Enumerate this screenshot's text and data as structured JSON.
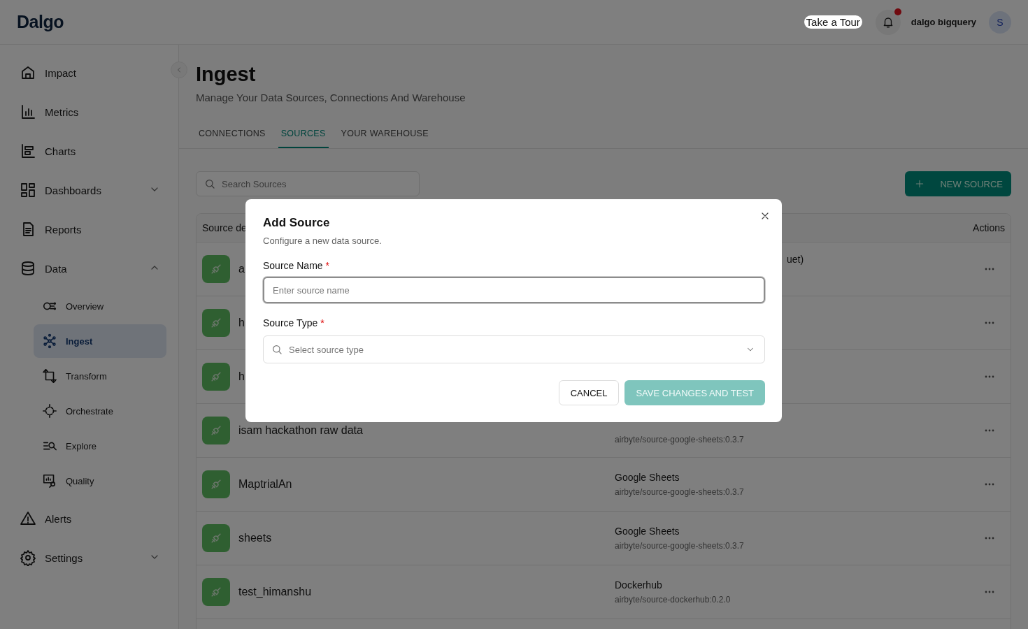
{
  "header": {
    "logo": "Dalgo",
    "tour_button": "Take a Tour",
    "notifications": {
      "unread": true
    },
    "user_name": "dalgo bigquery",
    "avatar": "S"
  },
  "sidebar": {
    "items": [
      {
        "label": "Impact",
        "kind": "link",
        "selected": false
      },
      {
        "label": "Metrics",
        "kind": "link",
        "selected": false
      },
      {
        "label": "Charts",
        "kind": "link",
        "selected": false
      },
      {
        "label": "Dashboards",
        "kind": "group",
        "expanded": false,
        "selected": false
      },
      {
        "label": "Reports",
        "kind": "link",
        "selected": false
      },
      {
        "label": "Data",
        "kind": "group",
        "expanded": true,
        "selected": false,
        "children": [
          {
            "label": "Overview",
            "selected": false
          },
          {
            "label": "Ingest",
            "selected": true
          },
          {
            "label": "Transform",
            "selected": false
          },
          {
            "label": "Orchestrate",
            "selected": false
          },
          {
            "label": "Explore",
            "selected": false
          },
          {
            "label": "Quality",
            "selected": false
          }
        ]
      },
      {
        "label": "Alerts",
        "kind": "link",
        "selected": false
      },
      {
        "label": "Settings",
        "kind": "group",
        "expanded": false,
        "selected": false
      }
    ]
  },
  "page": {
    "title": "Ingest",
    "subtitle": "Manage Your Data Sources, Connections And Warehouse",
    "tabs": [
      {
        "label": "CONNECTIONS",
        "selected": false
      },
      {
        "label": "SOURCES",
        "selected": true
      },
      {
        "label": "YOUR WAREHOUSE",
        "selected": false
      }
    ],
    "search": {
      "placeholder": "Search Sources"
    },
    "new_button": "NEW SOURCE"
  },
  "table": {
    "columns": [
      "Source de",
      "Actions"
    ],
    "rows": [
      {
        "name": "a",
        "type": "uet)"
      },
      {
        "name": "h"
      },
      {
        "name": "h"
      },
      {
        "name": "isam hackathon raw data",
        "version": "airbyte/source-google-sheets:0.3.7"
      },
      {
        "name": "MaptrialAn",
        "type": "Google Sheets",
        "version": "airbyte/source-google-sheets:0.3.7"
      },
      {
        "name": "sheets",
        "type": "Google Sheets",
        "version": "airbyte/source-google-sheets:0.3.7"
      },
      {
        "name": "test_himanshu",
        "type": "Dockerhub",
        "version": "airbyte/source-dockerhub:0.2.0"
      }
    ]
  },
  "dialog": {
    "title": "Add Source",
    "subtitle": "Configure a new data source.",
    "fields": [
      {
        "kind": "text",
        "label": "Source Name",
        "required_mark": "*",
        "placeholder": "Enter source name",
        "focused": true
      },
      {
        "kind": "select",
        "label": "Source Type",
        "required_mark": "*",
        "placeholder": "Select source type",
        "focused": false
      }
    ],
    "buttons": [
      {
        "kind": "secondary",
        "label": "CANCEL"
      },
      {
        "kind": "primary",
        "label": "SAVE CHANGES AND TEST",
        "disabled": true
      }
    ]
  }
}
